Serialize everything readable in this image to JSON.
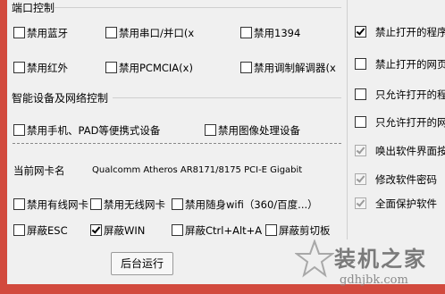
{
  "sections": {
    "port_control": "端口控制",
    "smart_device": "智能设备及网络控制"
  },
  "port": {
    "bluetooth": "禁用蓝牙",
    "serial": "禁用串口/并口(x",
    "ieee1394": "禁用1394",
    "infrared": "禁用红外",
    "pcmcia": "禁用PCMCIA(x)",
    "modem": "禁用调制解调器(x"
  },
  "device": {
    "mobile": "禁用手机、PAD等便携式设备",
    "imaging": "禁用图像处理设备"
  },
  "nic": {
    "label": "当前网卡名",
    "value": "Qualcomm Atheros AR8171/8175 PCI-E Gigabit"
  },
  "net": {
    "wired": "禁用有线网卡",
    "wireless": "禁用无线网卡",
    "portable_wifi": "禁用随身wifi（360/百度...）"
  },
  "shield": {
    "esc": "屏蔽ESC",
    "win": "屏蔽WIN",
    "ctrl_alt_a": "屏蔽Ctrl+Alt+A",
    "cut": "屏蔽剪切板"
  },
  "right": {
    "r1": "禁止打开的程序",
    "r2": "禁止打开的网页",
    "r3": "只允许打开的程",
    "r4": "只允许打开的网",
    "r5": "唤出软件界面按",
    "r6": "修改软件密码",
    "r7": "全面保护软件"
  },
  "button": {
    "run_background": "后台运行"
  },
  "watermark": {
    "title": "装机之家",
    "url": "gdhjbk.com"
  }
}
